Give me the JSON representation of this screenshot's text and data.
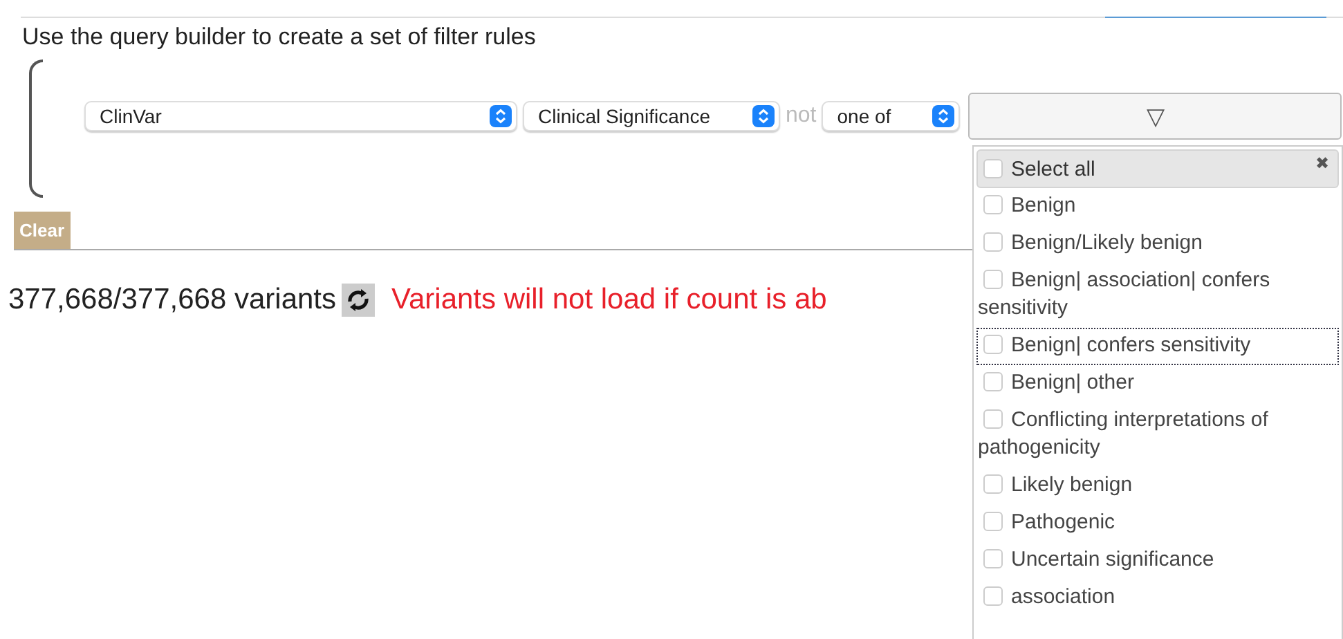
{
  "instructions": "Use the query builder to create a set of filter rules",
  "rule": {
    "source": "ClinVar",
    "field": "Clinical Significance",
    "negation": "not",
    "operator": "one of",
    "value_toggle": "▽"
  },
  "clear_button": "Clear",
  "count": "377,668/377,668 variants",
  "warning": "Variants will not load if count is ab",
  "dropdown": {
    "select_all": {
      "label": "Select all",
      "checked": false
    },
    "close": "✖",
    "options": [
      {
        "label": "Benign",
        "checked": false,
        "focused": false
      },
      {
        "label": "Benign/Likely benign",
        "checked": false,
        "focused": false
      },
      {
        "label": "Benign| association| confers sensitivity",
        "checked": false,
        "focused": false
      },
      {
        "label": "Benign| confers sensitivity",
        "checked": false,
        "focused": true
      },
      {
        "label": "Benign| other",
        "checked": false,
        "focused": false
      },
      {
        "label": "Conflicting interpretations of pathogenicity",
        "checked": false,
        "focused": false
      },
      {
        "label": "Likely benign",
        "checked": false,
        "focused": false
      },
      {
        "label": "Pathogenic",
        "checked": false,
        "focused": false
      },
      {
        "label": "Uncertain significance",
        "checked": false,
        "focused": false
      },
      {
        "label": "association",
        "checked": false,
        "focused": false
      }
    ]
  }
}
